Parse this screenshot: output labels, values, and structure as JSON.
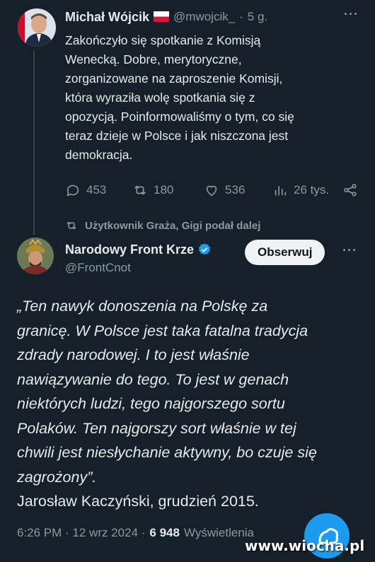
{
  "post1": {
    "author_name": "Michał Wójcik",
    "handle": "@mwojcik_",
    "separator": "·",
    "time": "5 g.",
    "more": "···",
    "text": "Zakończyło się spotkanie z Komisją Wenecką. Dobre, merytoryczne, zorganizowane na zaproszenie Komisji, która wyraziła wolę spotkania się z opozycją. Poinformowaliśmy o tym, co się teraz dzieje w Polsce i jak niszczona jest demokracja.",
    "lines": [
      "Zakończyło się spotkanie z Komisją",
      "Wenecką. Dobre, merytoryczne,",
      "zorganizowane na zaproszenie Komisji,",
      "która wyraziła wolę spotkania się z",
      "opozycją. Poinformowaliśmy o tym, co się",
      "teraz dzieje w Polsce i jak niszczona jest",
      "demokracja."
    ],
    "actions": {
      "replies": "453",
      "reposts": "180",
      "likes": "536",
      "views": "26 tys."
    },
    "icons": [
      "reply-icon",
      "repost-icon",
      "like-icon",
      "views-icon",
      "share-icon"
    ],
    "flag_colors": {
      "top": "#ffffff",
      "bottom": "#dc143c"
    }
  },
  "repost_note": {
    "text": "Użytkownik Graża, Gigi podał dalej"
  },
  "post2": {
    "author_name": "Narodowy Front Krze",
    "handle": "@FrontCnot",
    "follow_label": "Obserwuj",
    "more": "···",
    "quote_lines": [
      "„Ten nawyk donoszenia na Polskę za",
      "granicę. W Polsce jest taka fatalna tradycja",
      "zdrady narodowej. I to jest właśnie",
      "nawiązywanie do tego. To jest w genach",
      "niektórych ludzi, tego najgorszego sortu",
      "Polaków. Ten najgorszy sort właśnie w tej",
      "chwili jest niesłychanie aktywny, bo czuje się",
      "zagrożony”."
    ],
    "attribution": "Jarosław Kaczyński, grudzień 2015.",
    "timestamp": "6:26 PM · 12 wrz 2024 ·",
    "view_count": "6 948",
    "views_label": "Wyświetlenia"
  },
  "watermark": "www.wiocha.pl",
  "colors": {
    "background": "#15202b",
    "text": "#e7e9ea",
    "muted": "#8b98a5",
    "verified": "#1d9bf0",
    "fab": "#1d9bf0"
  }
}
